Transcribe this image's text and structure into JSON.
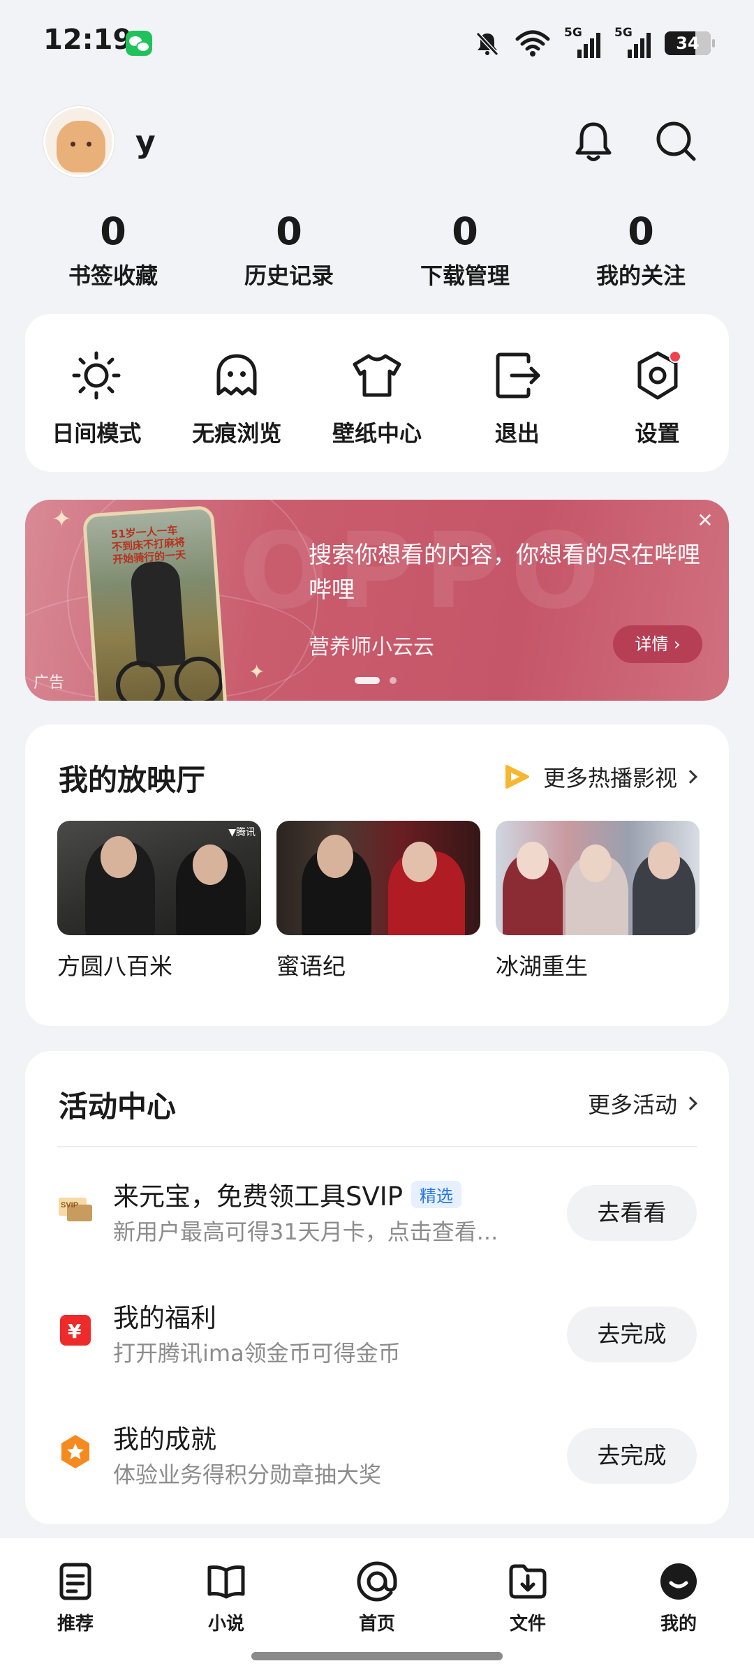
{
  "status_bar": {
    "time": "12:19",
    "signal_1": "5G",
    "signal_2": "5G",
    "battery": "34"
  },
  "profile": {
    "username": "y"
  },
  "stats": [
    {
      "value": "0",
      "label": "书签收藏"
    },
    {
      "value": "0",
      "label": "历史记录"
    },
    {
      "value": "0",
      "label": "下载管理"
    },
    {
      "value": "0",
      "label": "我的关注"
    }
  ],
  "tools": [
    {
      "label": "日间模式",
      "icon": "sun-icon"
    },
    {
      "label": "无痕浏览",
      "icon": "ghost-icon"
    },
    {
      "label": "壁纸中心",
      "icon": "shirt-icon"
    },
    {
      "label": "退出",
      "icon": "logout-icon"
    },
    {
      "label": "设置",
      "icon": "settings-icon"
    }
  ],
  "ad": {
    "headline": "搜索你想看的内容，你想看的尽在哔哩哔哩",
    "source": "营养师小云云",
    "detail_button": "详情 ›",
    "tag": "广告",
    "close": "✕",
    "phone_text_1": "51岁一人一车",
    "phone_text_2": "不到床不打麻将",
    "phone_text_3": "开始骑行的一天",
    "watermark": "OPPO"
  },
  "cinema": {
    "title": "我的放映厅",
    "more": "更多热播影视",
    "movies": [
      {
        "title": "方圆八百米",
        "badge": "▼腾讯"
      },
      {
        "title": "蜜语纪"
      },
      {
        "title": "冰湖重生"
      }
    ]
  },
  "activity": {
    "title": "活动中心",
    "more": "更多活动",
    "items": [
      {
        "title": "来元宝，免费领工具SVIP",
        "badge": "精选",
        "subtitle": "新用户最高可得31天月卡，点击查看...",
        "button": "去看看",
        "icon": "svip-ticket-icon"
      },
      {
        "title": "我的福利",
        "subtitle": "打开腾讯ima领金币可得金币",
        "button": "去完成",
        "icon": "yuan-coin-icon"
      },
      {
        "title": "我的成就",
        "subtitle": "体验业务得积分勋章抽大奖",
        "button": "去完成",
        "icon": "medal-icon"
      }
    ]
  },
  "bottom_nav": [
    {
      "label": "推荐",
      "icon": "document-icon"
    },
    {
      "label": "小说",
      "icon": "book-icon"
    },
    {
      "label": "首页",
      "icon": "home-at-icon"
    },
    {
      "label": "文件",
      "icon": "folder-download-icon"
    },
    {
      "label": "我的",
      "icon": "profile-smile-icon"
    }
  ],
  "colors": {
    "background": "#f2f3f7",
    "accent_red": "#f0414f",
    "ad_gradient": "#c95c6d",
    "badge_blue": "#2a78e3"
  }
}
